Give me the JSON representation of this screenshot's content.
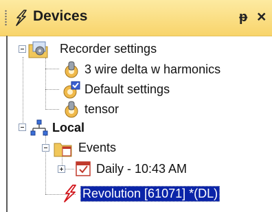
{
  "panel": {
    "title": "Devices",
    "title_icon": "lightning-icon",
    "pin_label": "ᵽ",
    "close_label": "×"
  },
  "tree": {
    "recorder_settings": {
      "label": "Recorder settings",
      "icon": "folder-settings-icon",
      "children": [
        {
          "label": "3 wire delta w harmonics",
          "icon": "gear-person-icon"
        },
        {
          "label": "Default settings",
          "icon": "gear-check-icon"
        },
        {
          "label": "tensor",
          "icon": "gear-person-icon"
        }
      ]
    },
    "local": {
      "label": "Local",
      "icon": "network-icon",
      "events": {
        "label": "Events",
        "icon": "folder-events-icon",
        "daily": {
          "label": "Daily - 10:43 AM",
          "icon": "calendar-icon"
        }
      },
      "revolution": {
        "label": "Revolution [61071] *(DL)",
        "icon": "lightning-red-icon"
      }
    }
  },
  "colors": {
    "header_bg": "#f8d46b",
    "selection_bg": "#0a24a8",
    "lightning_red": "#d2151b",
    "folder_yellow": "#f1c75a"
  }
}
